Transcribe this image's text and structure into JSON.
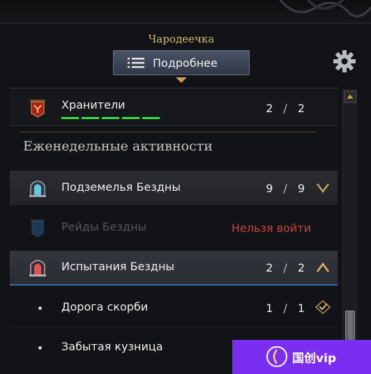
{
  "header": {
    "character_name": "Чародеечка",
    "details_button_label": "Подробнее"
  },
  "guardians": {
    "label": "Хранители",
    "current": "2",
    "max": "2",
    "progress": 1.0
  },
  "weekly": {
    "section_title": "Еженедельные активности",
    "items": [
      {
        "label": "Подземелья Бездны",
        "current": "9",
        "max": "9",
        "state": "collapsed"
      },
      {
        "label": "Рейды Бездны",
        "status": "Нельзя войти",
        "state": "disabled"
      },
      {
        "label": "Испытания Бездны",
        "current": "2",
        "max": "2",
        "state": "expanded"
      }
    ],
    "sub_items": [
      {
        "label": "Дорога скорби",
        "current": "1",
        "max": "1"
      },
      {
        "label": "Забытая кузница"
      }
    ]
  },
  "separator_symbol": "/",
  "watermark": {
    "text": "国创vip"
  },
  "colors": {
    "accent_gold": "#d9b877",
    "progress_green": "#35e040",
    "blocked_red": "#c9433b",
    "selected_blue": "#3b6bb0"
  }
}
